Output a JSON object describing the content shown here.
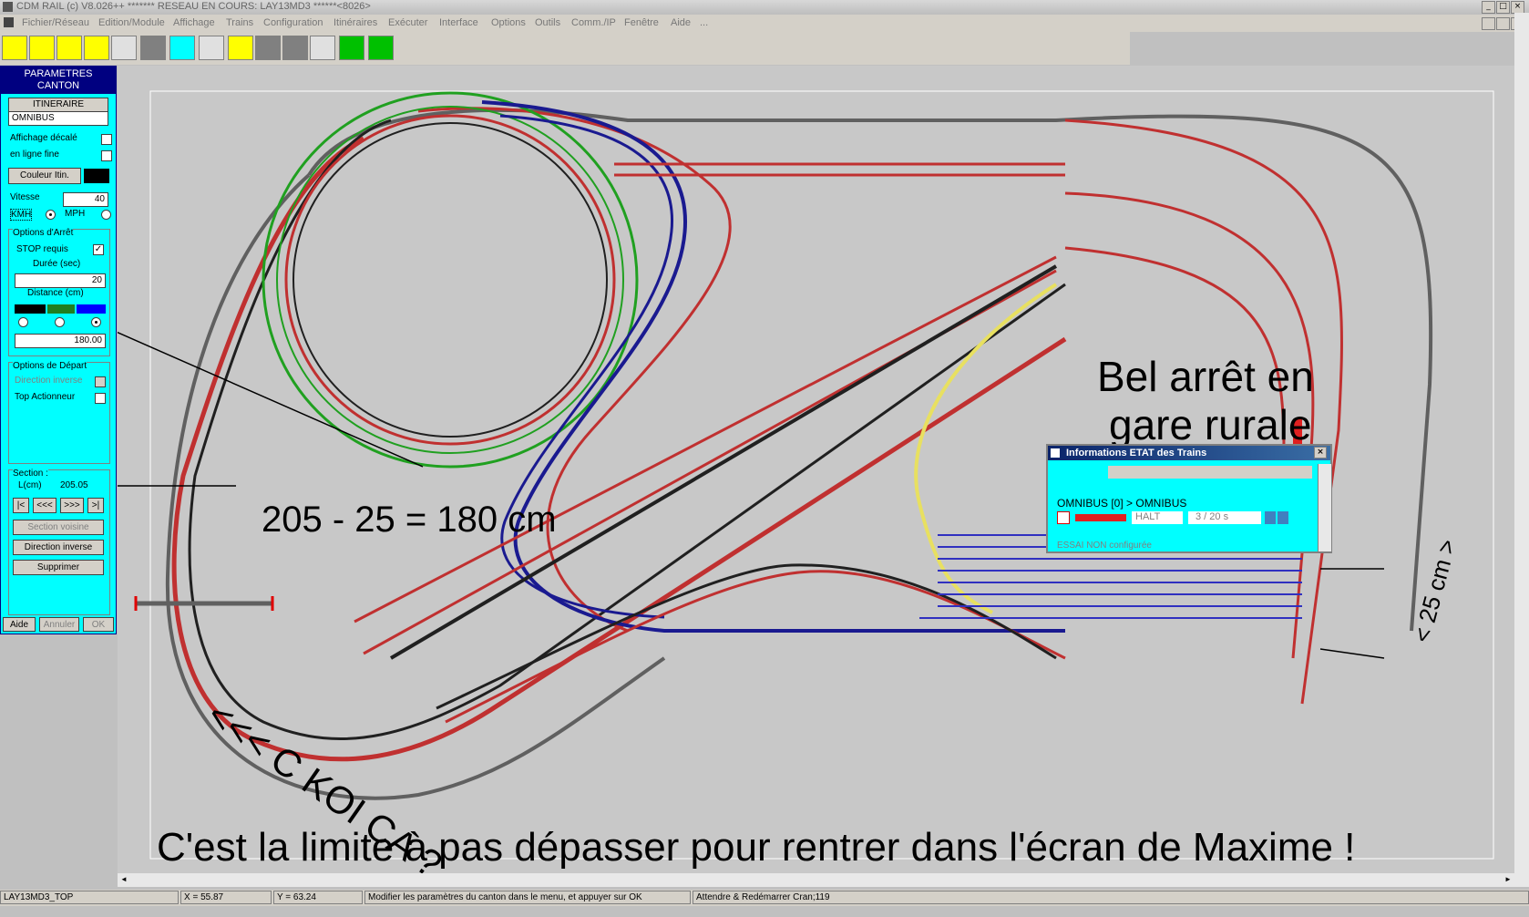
{
  "window": {
    "title": "CDM RAIL (c) V8.026++       ******* RESEAU EN COURS: LAY13MD3 ******<8026>",
    "controls": [
      "_",
      "□",
      "×"
    ]
  },
  "menu": [
    "Fichier/Réseau",
    "Edition/Module",
    "Affichage",
    "Trains",
    "Configuration",
    "Itinéraires",
    "Exécuter",
    "Interface",
    "Options",
    "Outils",
    "Comm./IP",
    "Fenêtre",
    "Aide",
    "..."
  ],
  "panel": {
    "header_line1": "PARAMETRES",
    "header_line2": "CANTON",
    "itineraire_label": "ITINERAIRE",
    "itineraire_value": "OMNIBUS",
    "affichage_decale": "Affichage décalé",
    "en_ligne_fine": "en ligne fine",
    "couleur_itin": "Couleur Itin.",
    "vitesse_label": "Vitesse",
    "vitesse_value": "40",
    "kmh": "KMH",
    "mph": "MPH",
    "options_arret": "Options d'Arrêt",
    "stop_requis": "STOP requis",
    "stop_checked": "✓",
    "duree_label": "Durée (sec)",
    "duree_value": "20",
    "distance_label": "Distance (cm)",
    "distance_value": "180.00",
    "options_depart": "Options de Départ",
    "direction_inverse_opt": "Direction inverse",
    "top_actionneur": "Top Actionneur",
    "section_label": "Section :",
    "lcm_label": "L(cm)",
    "lcm_value": "205.05",
    "nav": [
      "|<",
      "<<<",
      ">>>",
      ">|"
    ],
    "section_voisine": "Section voisine",
    "direction_inverse_btn": "Direction inverse",
    "supprimer": "Supprimer",
    "aide": "Aide",
    "annuler": "Annuler",
    "ok": "OK"
  },
  "annotations": {
    "formula": "205 - 25 = 180 cm",
    "bel_arret_1": "Bel arrêt en",
    "bel_arret_2": "gare rurale",
    "ckoica": "<<< C KOI CA ?",
    "bottom_note": "C'est la limite à pas dépasser pour rentrer dans l'écran de Maxime !",
    "dim_25": "< 25 cm >"
  },
  "etat_dialog": {
    "title": "Informations ETAT des Trains",
    "train_line": "OMNIBUS [0] > OMNIBUS",
    "state": "HALT",
    "counter": "3 /  20 s",
    "essai": "ESSAI NON configurée"
  },
  "status": {
    "layout": "LAY13MD3_TOP",
    "x": "X =      55.87",
    "y": "Y =      63.24",
    "message": "Modifier les paramètres du canton dans le menu, et appuyer sur OK",
    "info": "Attendre & Redémarrer Cran;119"
  },
  "colors": {
    "panel_bg": "#00ffff",
    "track_red": "#d04040",
    "track_green": "#20a020",
    "track_blue": "#1a1a90",
    "track_yellow": "#e8e060"
  }
}
